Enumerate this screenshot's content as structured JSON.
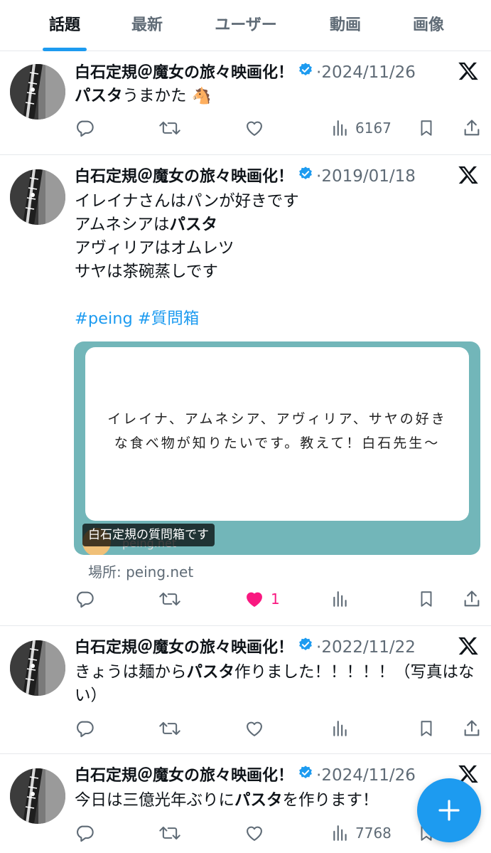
{
  "tabs": [
    {
      "label": "話題",
      "active": true
    },
    {
      "label": "最新"
    },
    {
      "label": "ユーザー"
    },
    {
      "label": "動画"
    },
    {
      "label": "画像"
    }
  ],
  "accent": "#1d9bf0",
  "like_color": "#f91880",
  "tweets": [
    {
      "author": "白石定規＠魔女の旅々映画化！",
      "sep": "·",
      "date": "2024/11/26",
      "text_pre": "",
      "text_bold": "パスタ",
      "text_post": "うまかた 🐴",
      "views": "6167"
    },
    {
      "author": "白石定規＠魔女の旅々映画化！",
      "sep": "·",
      "date": "2019/01/18",
      "line1": "イレイナさんはパンが好きです",
      "line2_pre": "アムネシアは",
      "line2_bold": "パスタ",
      "line3": "アヴィリアはオムレツ",
      "line4": "サヤは茶碗蒸しです",
      "hashtags": "#peing #質問箱",
      "card": {
        "question": "イレイナ、アムネシア、アヴィリア、サヤの好きな食べ物が知りたいです。教えて！白石先生〜",
        "site": "peing.net",
        "caption": "白石定規の質問箱です"
      },
      "source": "場所: peing.net",
      "likes": "1"
    },
    {
      "author": "白石定規＠魔女の旅々映画化！",
      "sep": "·",
      "date": "2022/11/22",
      "text_pre": "きょうは麺から",
      "text_bold": "パスタ",
      "text_post": "作りました！！！！！（写真はない）"
    },
    {
      "author": "白石定規＠魔女の旅々映画化！",
      "sep": "·",
      "date": "2024/11/26",
      "text_pre": "今日は三億光年ぶりに",
      "text_bold": "パスタ",
      "text_post": "を作ります！",
      "views": "7768"
    }
  ],
  "icons": [
    "reply-icon",
    "retweet-icon",
    "like-icon",
    "views-icon",
    "bookmark-icon",
    "share-icon",
    "verified-icon",
    "x-logo-icon",
    "compose-plus-icon"
  ]
}
